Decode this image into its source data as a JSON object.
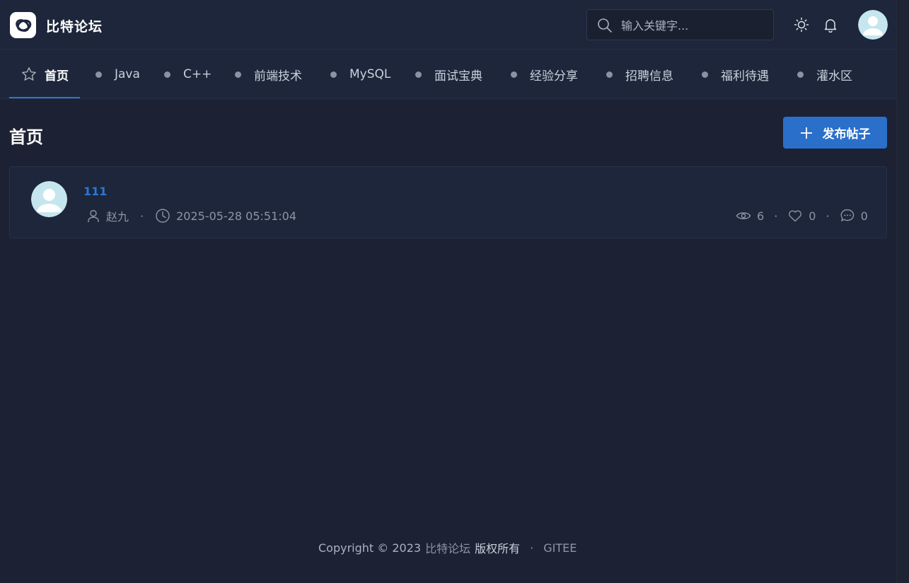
{
  "header": {
    "brand": "比特论坛",
    "search_placeholder": "输入关键字..."
  },
  "nav": {
    "items": [
      {
        "label": "首页"
      },
      {
        "label": "Java"
      },
      {
        "label": "C++"
      },
      {
        "label": "前端技术"
      },
      {
        "label": "MySQL"
      },
      {
        "label": "面试宝典"
      },
      {
        "label": "经验分享"
      },
      {
        "label": "招聘信息"
      },
      {
        "label": "福利待遇"
      },
      {
        "label": "灌水区"
      }
    ]
  },
  "main": {
    "title": "首页",
    "publish_label": "发布帖子",
    "posts": [
      {
        "title": "111",
        "author": "赵九",
        "time": "2025-05-28 05:51:04",
        "views": "6",
        "likes": "0",
        "comments": "0"
      }
    ]
  },
  "footer": {
    "copyright": "Copyright © 2023",
    "brand": "比特论坛",
    "rights": "版权所有",
    "separator": "·",
    "link": "GITEE"
  },
  "colors": {
    "accent": "#2a79d6",
    "background": "#1c2133",
    "panel": "#1d263a"
  }
}
